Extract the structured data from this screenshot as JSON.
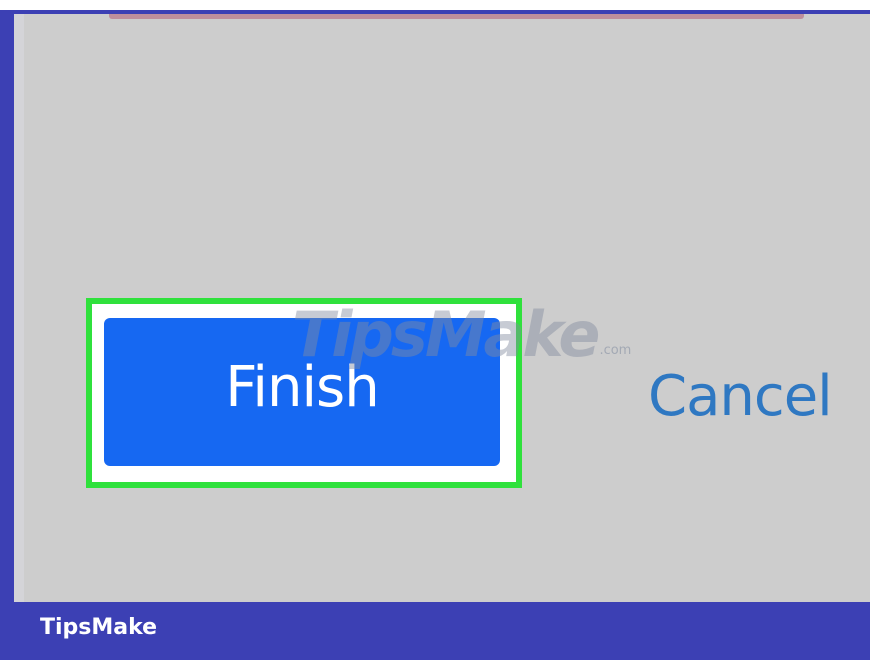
{
  "dialog": {
    "finish_label": "Finish",
    "cancel_label": "Cancel"
  },
  "watermark": {
    "text": "TipsMake",
    "suffix": ".com"
  },
  "footer": {
    "brand": "TipsMake"
  },
  "colors": {
    "frame": "#3c40b4",
    "window_bg": "#cdcdcd",
    "highlight": "#2fe13c",
    "primary_button": "#1668f2",
    "cancel_text": "#2f78c2"
  }
}
